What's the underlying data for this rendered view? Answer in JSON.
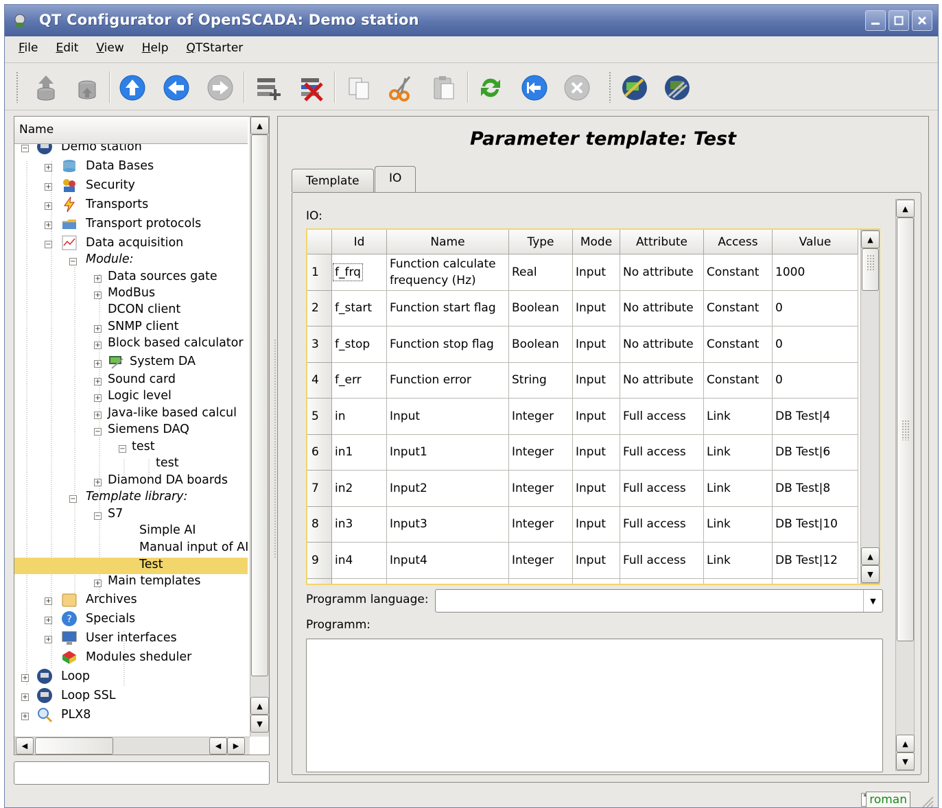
{
  "window": {
    "title": "QT Configurator of OpenSCADA: Demo station"
  },
  "menu": [
    "File",
    "Edit",
    "View",
    "Help",
    "QTStarter"
  ],
  "tree": {
    "header": "Name",
    "nodes": [
      {
        "label": "Demo station"
      },
      {
        "label": "Data Bases"
      },
      {
        "label": "Security"
      },
      {
        "label": "Transports"
      },
      {
        "label": "Transport protocols"
      },
      {
        "label": "Data acquisition"
      },
      {
        "label": "Module:"
      },
      {
        "label": "Data sources gate"
      },
      {
        "label": "ModBus"
      },
      {
        "label": "DCON client"
      },
      {
        "label": "SNMP client"
      },
      {
        "label": "Block based calculator"
      },
      {
        "label": "System DA"
      },
      {
        "label": "Sound card"
      },
      {
        "label": "Logic level"
      },
      {
        "label": "Java-like based calcul"
      },
      {
        "label": "Siemens DAQ"
      },
      {
        "label": "test"
      },
      {
        "label": "test"
      },
      {
        "label": "Diamond DA boards"
      },
      {
        "label": "Template library:"
      },
      {
        "label": "S7"
      },
      {
        "label": "Simple AI"
      },
      {
        "label": "Manual input of AI"
      },
      {
        "label": "Test"
      },
      {
        "label": "Main templates"
      },
      {
        "label": "Archives"
      },
      {
        "label": "Specials"
      },
      {
        "label": "User interfaces"
      },
      {
        "label": "Modules sheduler"
      },
      {
        "label": "Loop"
      },
      {
        "label": "Loop SSL"
      },
      {
        "label": "PLX8"
      }
    ]
  },
  "page": {
    "title": "Parameter template: Test",
    "tabs": [
      "Template",
      "IO"
    ],
    "active_tab": "IO"
  },
  "io": {
    "label": "IO:",
    "columns": [
      "Id",
      "Name",
      "Type",
      "Mode",
      "Attribute",
      "Access",
      "Value"
    ],
    "rows": [
      {
        "n": "1",
        "id": "f_frq",
        "name": "Function calculate frequency (Hz)",
        "type": "Real",
        "mode": "Input",
        "attr": "No attribute",
        "access": "Constant",
        "value": "1000"
      },
      {
        "n": "2",
        "id": "f_start",
        "name": "Function start flag",
        "type": "Boolean",
        "mode": "Input",
        "attr": "No attribute",
        "access": "Constant",
        "value": "0"
      },
      {
        "n": "3",
        "id": "f_stop",
        "name": "Function stop flag",
        "type": "Boolean",
        "mode": "Input",
        "attr": "No attribute",
        "access": "Constant",
        "value": "0"
      },
      {
        "n": "4",
        "id": "f_err",
        "name": "Function error",
        "type": "String",
        "mode": "Input",
        "attr": "No attribute",
        "access": "Constant",
        "value": "0"
      },
      {
        "n": "5",
        "id": "in",
        "name": "Input",
        "type": "Integer",
        "mode": "Input",
        "attr": "Full access",
        "access": "Link",
        "value": "DB Test|4"
      },
      {
        "n": "6",
        "id": "in1",
        "name": "Input1",
        "type": "Integer",
        "mode": "Input",
        "attr": "Full access",
        "access": "Link",
        "value": "DB Test|6"
      },
      {
        "n": "7",
        "id": "in2",
        "name": "Input2",
        "type": "Integer",
        "mode": "Input",
        "attr": "Full access",
        "access": "Link",
        "value": "DB Test|8"
      },
      {
        "n": "8",
        "id": "in3",
        "name": "Input3",
        "type": "Integer",
        "mode": "Input",
        "attr": "Full access",
        "access": "Link",
        "value": "DB Test|10"
      },
      {
        "n": "9",
        "id": "in4",
        "name": "Input4",
        "type": "Integer",
        "mode": "Input",
        "attr": "Full access",
        "access": "Link",
        "value": "DB Test|12"
      }
    ]
  },
  "program": {
    "language_label": "Programm language:",
    "language_value": "",
    "text_label": "Programm:",
    "text_value": ""
  },
  "status": {
    "user": "roman"
  },
  "colors": {
    "selection": "#f3d66b",
    "title_bar": "#5c75ad",
    "user_text": "#1a8a1a"
  }
}
